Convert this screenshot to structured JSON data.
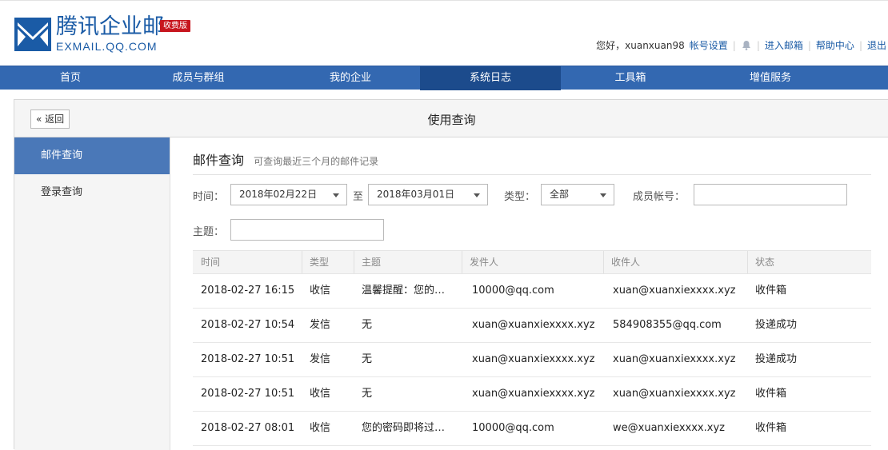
{
  "brand": {
    "name": "腾讯企业邮",
    "sub": "EXMAIL.QQ.COM",
    "badge": "收费版",
    "color": "#1a5ba6"
  },
  "user_bar": {
    "greeting": "您好，xuanxuan98",
    "account_settings": "帐号设置",
    "bell_icon": "bell-icon",
    "enter_mailbox": "进入邮箱",
    "help_center": "帮助中心",
    "logout": "退出"
  },
  "nav": {
    "color": "#3368b1",
    "active_color": "#1c4b8c",
    "items": [
      {
        "label": "首页"
      },
      {
        "label": "成员与群组"
      },
      {
        "label": "我的企业"
      },
      {
        "label": "系统日志",
        "active": true
      },
      {
        "label": "工具箱"
      },
      {
        "label": "增值服务"
      }
    ]
  },
  "titlebar": {
    "back_label": "« 返回",
    "title": "使用查询"
  },
  "sidebar": {
    "items": [
      {
        "label": "邮件查询",
        "active": true
      },
      {
        "label": "登录查询"
      }
    ]
  },
  "main": {
    "section_title": "邮件查询",
    "section_hint": "可查询最近三个月的邮件记录",
    "filters": {
      "time_label": "时间：",
      "start_date": "2018年02月22日",
      "to_label": "至",
      "end_date": "2018年03月01日",
      "type_label": "类型：",
      "type_value": "全部",
      "member_label": "成员帐号：",
      "member_value": "",
      "subject_label": "主题：",
      "subject_value": ""
    },
    "table": {
      "headers": [
        "时间",
        "类型",
        "主题",
        "发件人",
        "收件人",
        "状态"
      ],
      "rows": [
        [
          "2018-02-27 16:15",
          "收信",
          "温馨提醒：您的…",
          "10000@qq.com",
          "xuan@xuanxiexxxx.xyz",
          "收件箱"
        ],
        [
          "2018-02-27 10:54",
          "发信",
          "无",
          "xuan@xuanxiexxxx.xyz",
          "584908355@qq.com",
          "投递成功"
        ],
        [
          "2018-02-27 10:51",
          "发信",
          "无",
          "xuan@xuanxiexxxx.xyz",
          "xuan@xuanxiexxxx.xyz",
          "投递成功"
        ],
        [
          "2018-02-27 10:51",
          "收信",
          "无",
          "xuan@xuanxiexxxx.xyz",
          "xuan@xuanxiexxxx.xyz",
          "收件箱"
        ],
        [
          "2018-02-27 08:01",
          "收信",
          "您的密码即将过…",
          "10000@qq.com",
          "we@xuanxiexxxx.xyz",
          "收件箱"
        ]
      ]
    }
  }
}
